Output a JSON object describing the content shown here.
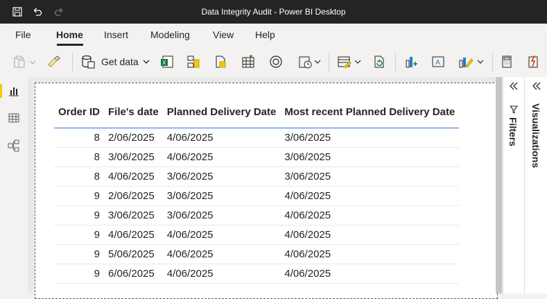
{
  "window": {
    "title": "Data Integrity Audit - Power BI Desktop"
  },
  "titlebar_icons": [
    "save-icon",
    "undo-icon",
    "redo-icon"
  ],
  "menu": {
    "items": [
      {
        "label": "File"
      },
      {
        "label": "Home"
      },
      {
        "label": "Insert"
      },
      {
        "label": "Modeling"
      },
      {
        "label": "View"
      },
      {
        "label": "Help"
      }
    ],
    "active": "Home"
  },
  "ribbon": {
    "get_data_label": "Get data",
    "icons": [
      "paste-icon",
      "format-painter-icon",
      "get-data-icon",
      "excel-icon",
      "sql-server-icon",
      "dataverse-icon",
      "enter-data-icon",
      "recent-sources-icon",
      "refresh-schedule-icon",
      "transform-data-icon",
      "refresh-icon",
      "new-visual-icon",
      "text-box-icon",
      "more-visuals-icon",
      "new-measure-icon",
      "quick-measure-icon"
    ]
  },
  "left_nav": {
    "items": [
      "report-view-icon",
      "table-view-icon",
      "model-view-icon"
    ],
    "active": "report-view-icon"
  },
  "table": {
    "columns": [
      "Order ID",
      "File's date",
      "Planned Delivery Date",
      "Most recent Planned Delivery Date"
    ],
    "rows": [
      [
        "8",
        "2/06/2025",
        "4/06/2025",
        "3/06/2025"
      ],
      [
        "8",
        "3/06/2025",
        "4/06/2025",
        "3/06/2025"
      ],
      [
        "8",
        "4/06/2025",
        "3/06/2025",
        "3/06/2025"
      ],
      [
        "9",
        "2/06/2025",
        "3/06/2025",
        "4/06/2025"
      ],
      [
        "9",
        "3/06/2025",
        "3/06/2025",
        "4/06/2025"
      ],
      [
        "9",
        "4/06/2025",
        "4/06/2025",
        "4/06/2025"
      ],
      [
        "9",
        "5/06/2025",
        "4/06/2025",
        "4/06/2025"
      ],
      [
        "9",
        "6/06/2025",
        "4/06/2025",
        "4/06/2025"
      ]
    ]
  },
  "panes": {
    "filters_label": "Filters",
    "visualizations_label": "Visualizations"
  },
  "colors": {
    "accent": "#f2c811",
    "header_rule": "#2b79d0",
    "titlebar": "#252423"
  }
}
